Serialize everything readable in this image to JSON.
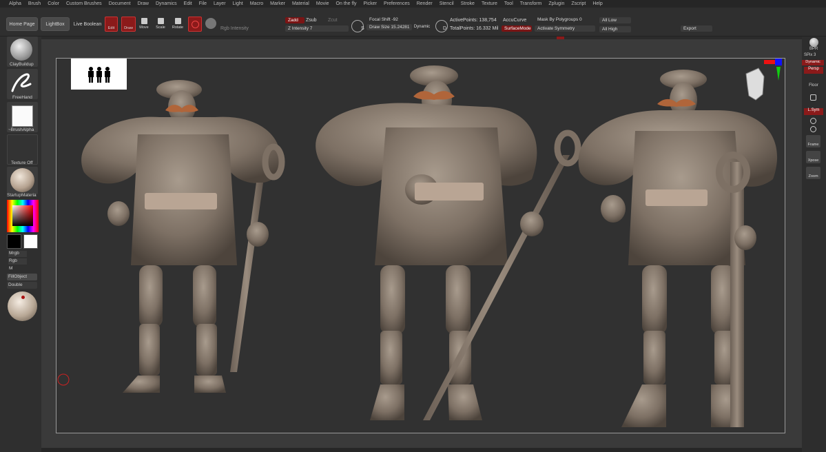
{
  "menu": [
    "Alpha",
    "Brush",
    "Color",
    "Custom Brushes",
    "Document",
    "Draw",
    "Dynamics",
    "Edit",
    "File",
    "Layer",
    "Light",
    "Macro",
    "Marker",
    "Material",
    "Movie",
    "On the fly",
    "Picker",
    "Preferences",
    "Render",
    "Stencil",
    "Stroke",
    "Texture",
    "Tool",
    "Transform",
    "Zplugin",
    "Zscript",
    "Help"
  ],
  "toolbar": {
    "home_page": "Home Page",
    "lightbox": "LightBox",
    "live_boolean": "Live Boolean",
    "edit": "Edit",
    "draw": "Draw",
    "move": "Move",
    "scale": "Scale",
    "rotate": "Rotate",
    "rgb_intensity": "Rgb Intensity",
    "zadd": "Zadd",
    "zsub": "Zsub",
    "zcut": "Zcut",
    "z_intensity": "Z Intensity 7",
    "focal_shift": "Focal Shift -92",
    "draw_size": "Draw Size 15.24281",
    "dynamic": "Dynamic",
    "s_label": "S",
    "d_label": "D",
    "active_points": "ActivePoints: 138,754",
    "total_points": "TotalPoints: 16.332 Mil",
    "accucurve": "AccuCurve",
    "surface_mode": "SurfaceMode",
    "mask_by_polygroups": "Mask By Polygroups 0",
    "activate_symmetry": "Activate Symmetry",
    "all_low": "All Low",
    "all_high": "All High",
    "export": "Export"
  },
  "leftshelf": {
    "brush": "ClayBuildup",
    "stroke": "FreeHand",
    "alpha": "~BrushAlpha",
    "texture": "Texture Off",
    "material": "StartupMateria",
    "mrgb": "Mrgb",
    "rgb": "Rgb",
    "m": "M",
    "fill_object": "FillObject",
    "double": "Double"
  },
  "rightshelf": {
    "bpr": "BPR",
    "spix": "SPix 3",
    "dynamic": "Dynamic",
    "persp": "Persp",
    "floor": "Floor",
    "local": "L.Sym",
    "frame": "Frame",
    "xpose": "Xpose",
    "zoom": "Zoom"
  },
  "colors": {
    "accent_red": "#8b1a1a",
    "clay": "#8a7d70",
    "mustache": "#b0653a"
  }
}
